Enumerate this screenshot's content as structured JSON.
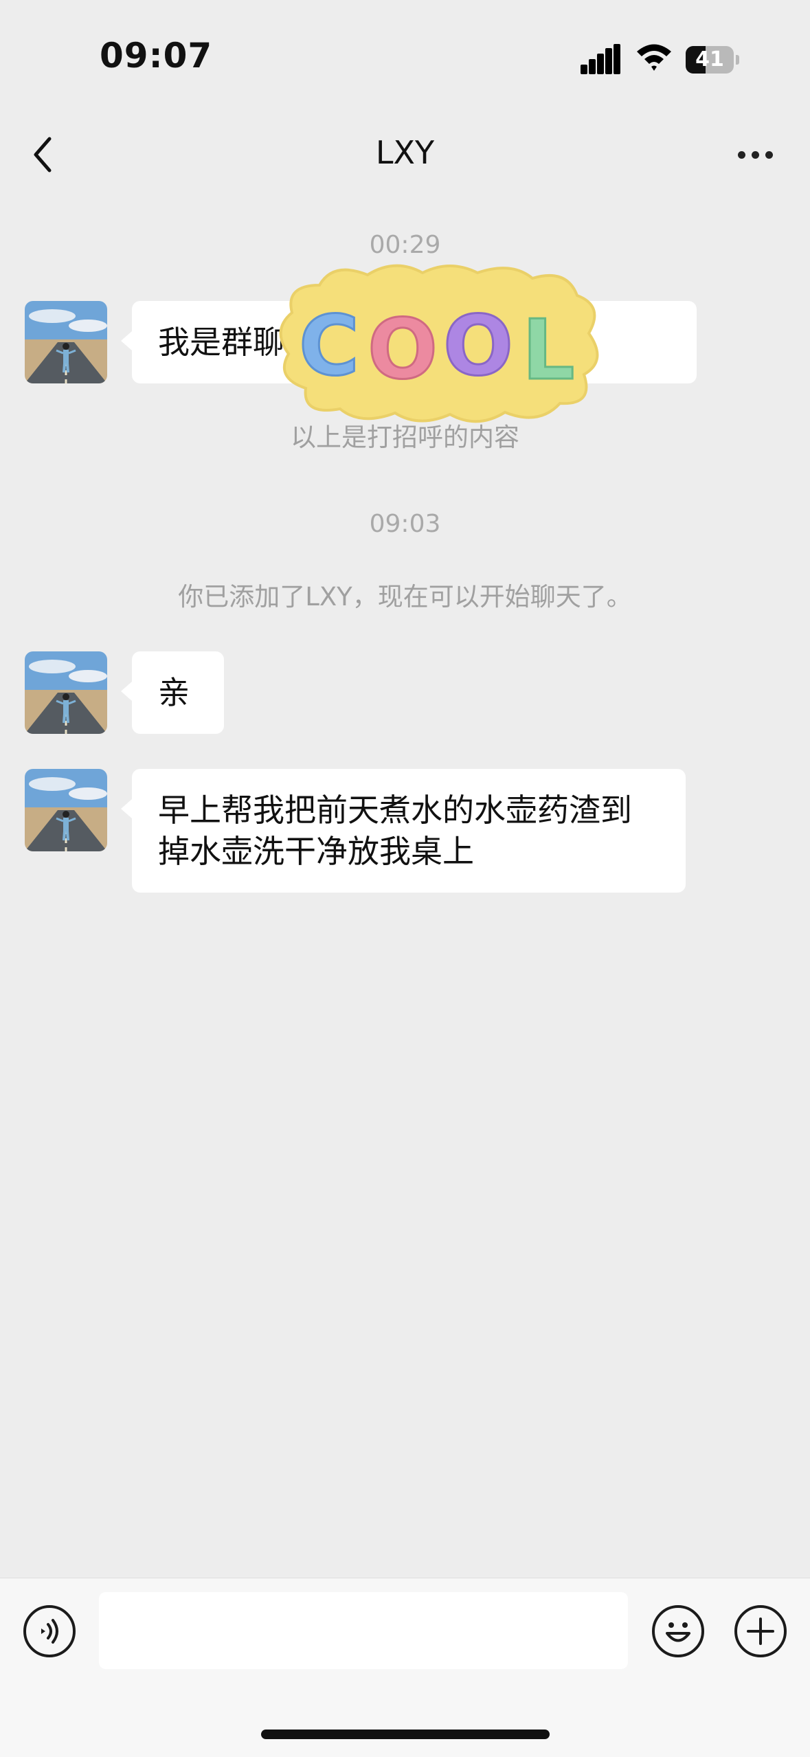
{
  "status_bar": {
    "time": "09:07",
    "battery": "41",
    "battery_level": 0.41
  },
  "nav": {
    "title": "LXY",
    "back_icon": "chevron-left-icon",
    "more_icon": "more-dots-icon"
  },
  "messages": {
    "stamp1": "00:29",
    "msg1": "我是群聊 … 的LXY",
    "sticker_text": "COOL",
    "sys1": "以上是打招呼的内容",
    "stamp2": "09:03",
    "sys2": "你已添加了LXY，现在可以开始聊天了。",
    "msg2": "亲",
    "msg3": "早上帮我把前天煮水的水壶药渣到掉水壶洗干净放我桌上"
  },
  "input_bar": {
    "voice_icon": "voice-icon",
    "input_value": "",
    "emoji_icon": "emoji-icon",
    "plus_icon": "plus-icon"
  },
  "colors": {
    "background": "#ededed",
    "bubble": "#ffffff",
    "meta_text": "#a9a9a9"
  }
}
